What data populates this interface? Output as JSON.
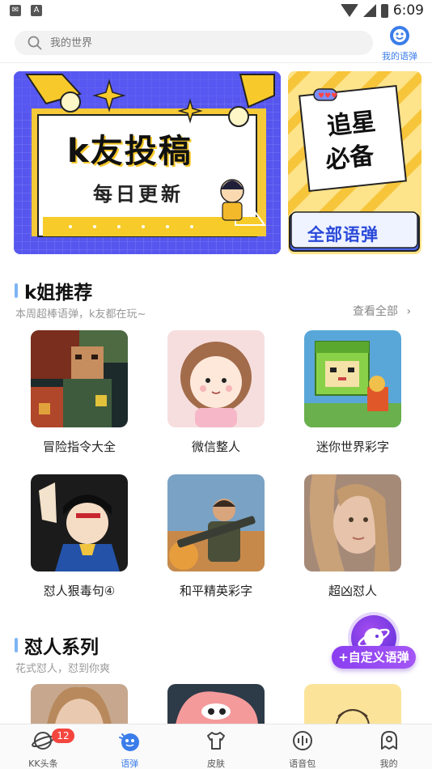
{
  "status_bar": {
    "time": "6:09",
    "left_icons": [
      "mail-icon",
      "a-icon"
    ]
  },
  "search": {
    "placeholder": "我的世界"
  },
  "my_voice": {
    "label": "我的语弹"
  },
  "banners": {
    "main": {
      "title": "k友投稿",
      "subtitle": "每日更新"
    },
    "side": {
      "title_line1": "追星",
      "title_line2": "必备",
      "button": "全部语弹"
    }
  },
  "section_recommend": {
    "title": "k姐推荐",
    "subtitle": "本周超棒语弹，k友都在玩~",
    "see_all": "查看全部",
    "items": [
      {
        "label": "冒险指令大全"
      },
      {
        "label": "微信整人"
      },
      {
        "label": "迷你世界彩字"
      },
      {
        "label": "怼人狠毒句④"
      },
      {
        "label": "和平精英彩字"
      },
      {
        "label": "超凶怼人"
      }
    ]
  },
  "section_roast": {
    "title": "怼人系列",
    "subtitle": "花式怼人，怼到你爽"
  },
  "fab": {
    "label": "+自定义语弹"
  },
  "bottom_nav": [
    {
      "label": "KK头条",
      "badge": "12",
      "icon": "planet-icon"
    },
    {
      "label": "语弹",
      "icon": "bomb-icon"
    },
    {
      "label": "皮肤",
      "icon": "tshirt-icon"
    },
    {
      "label": "语音包",
      "icon": "voice-icon"
    },
    {
      "label": "我的",
      "icon": "ghost-icon"
    }
  ],
  "colors": {
    "accent": "#3b7dea",
    "badge": "#f4463e",
    "fab": "#8a3ef0",
    "section_bar": "#7db5f4"
  }
}
